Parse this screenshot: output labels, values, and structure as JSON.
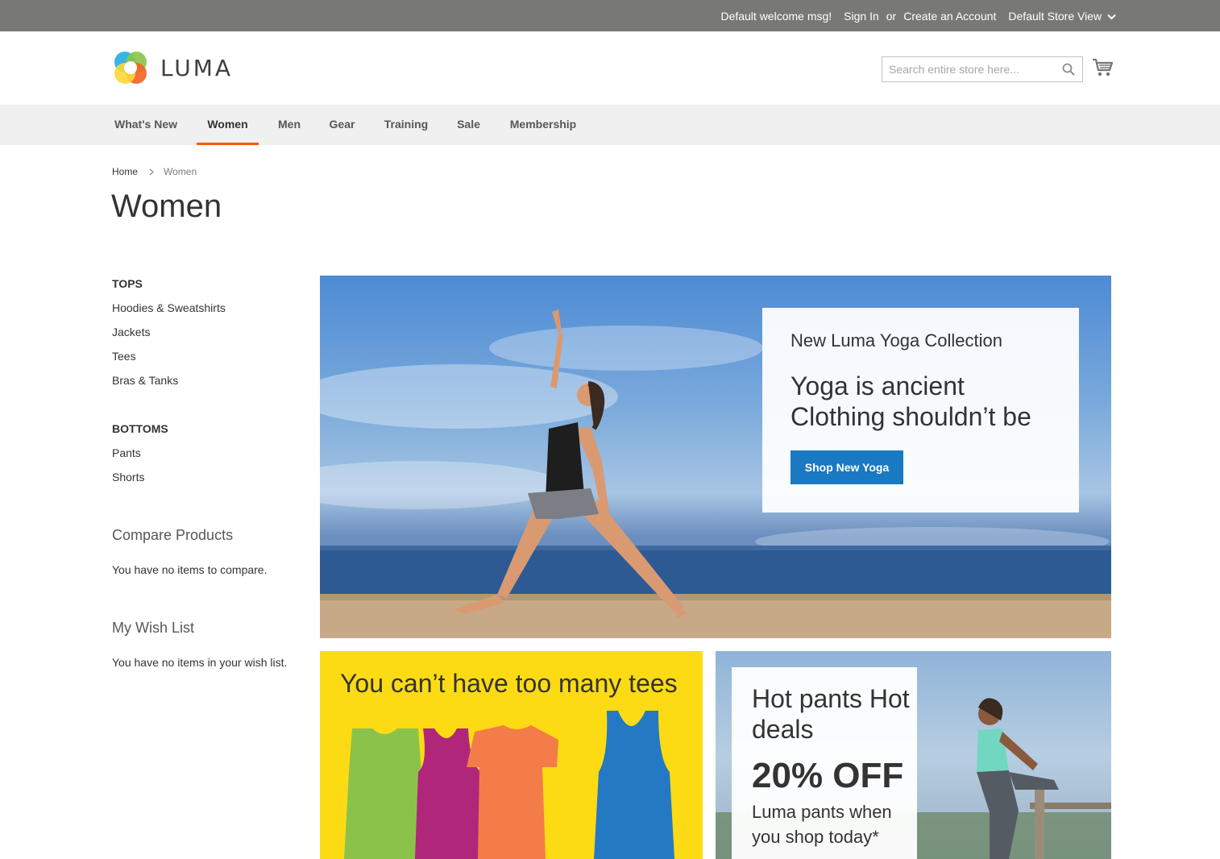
{
  "topbar": {
    "welcome": "Default welcome msg!",
    "sign_in": "Sign In",
    "or": "or",
    "create_account": "Create an Account",
    "store_view": "Default Store View"
  },
  "header": {
    "logo_text": "LUMA",
    "search_placeholder": "Search entire store here..."
  },
  "nav": {
    "items": [
      {
        "label": "What's New",
        "active": false
      },
      {
        "label": "Women",
        "active": true
      },
      {
        "label": "Men",
        "active": false
      },
      {
        "label": "Gear",
        "active": false
      },
      {
        "label": "Training",
        "active": false
      },
      {
        "label": "Sale",
        "active": false
      },
      {
        "label": "Membership",
        "active": false
      }
    ],
    "active_color": "#ff5501"
  },
  "breadcrumb": {
    "home": "Home",
    "current": "Women"
  },
  "page_title": "Women",
  "sidebar": {
    "tops_heading": "TOPS",
    "tops_items": [
      "Hoodies & Sweatshirts",
      "Jackets",
      "Tees",
      "Bras & Tanks"
    ],
    "bottoms_heading": "BOTTOMS",
    "bottoms_items": [
      "Pants",
      "Shorts"
    ],
    "compare_title": "Compare Products",
    "compare_note": "You have no items to compare.",
    "wishlist_title": "My Wish List",
    "wishlist_note": "You have no items in your wish list."
  },
  "hero": {
    "subtitle": "New Luma Yoga Collection",
    "headline": "Yoga is ancient Clothing shouldn’t be",
    "button": "Shop New Yoga",
    "button_color": "#1979c3"
  },
  "tees_promo": {
    "title": "You can’t have too many tees",
    "background": "#fddb14",
    "tee_colors": [
      "#8bc34a",
      "#b0267a",
      "#f47c48",
      "#2479c2"
    ]
  },
  "pants_promo": {
    "headline": "Hot pants Hot deals",
    "offer": "20% OFF",
    "description": "Luma pants when you shop today*"
  },
  "icons": [
    "chevron-down-icon",
    "luma-logo-icon",
    "search-icon",
    "cart-icon",
    "chevron-right-icon"
  ]
}
